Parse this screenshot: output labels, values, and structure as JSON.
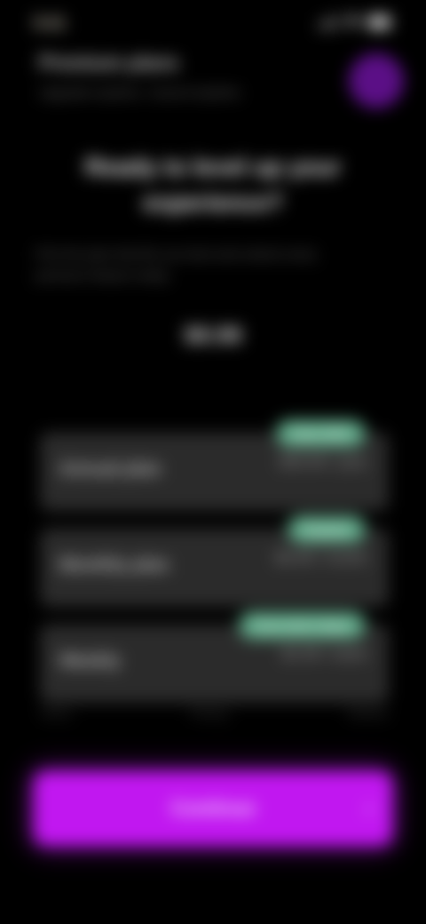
{
  "status_bar": {
    "time": "9:41"
  },
  "header": {
    "title": "Premium plans",
    "subtitle": "Upgrade anytime. Cancel anytime."
  },
  "hero": {
    "title": "Ready to level up your experience?",
    "body": "Pick the plan that fits you best and unlock every premium feature today.",
    "price": "$9.99"
  },
  "plans": [
    {
      "name": "Annual plan",
      "price": "$59.99 / year",
      "badge": "Save 50%"
    },
    {
      "name": "Monthly plan",
      "price": "$9.99 / month",
      "badge": "Popular"
    },
    {
      "name": "Weekly",
      "price": "$2.99 / week",
      "badge": "Free trial 3 days"
    }
  ],
  "terms": {
    "left": "Terms",
    "middle": "Privacy",
    "right": "Restore"
  },
  "cta": {
    "label": "Continue",
    "arrow": "›"
  },
  "colors": {
    "background": "#000000",
    "accent": "#c117f0",
    "badge": "#5fa888",
    "card": "#2b2b2b"
  }
}
